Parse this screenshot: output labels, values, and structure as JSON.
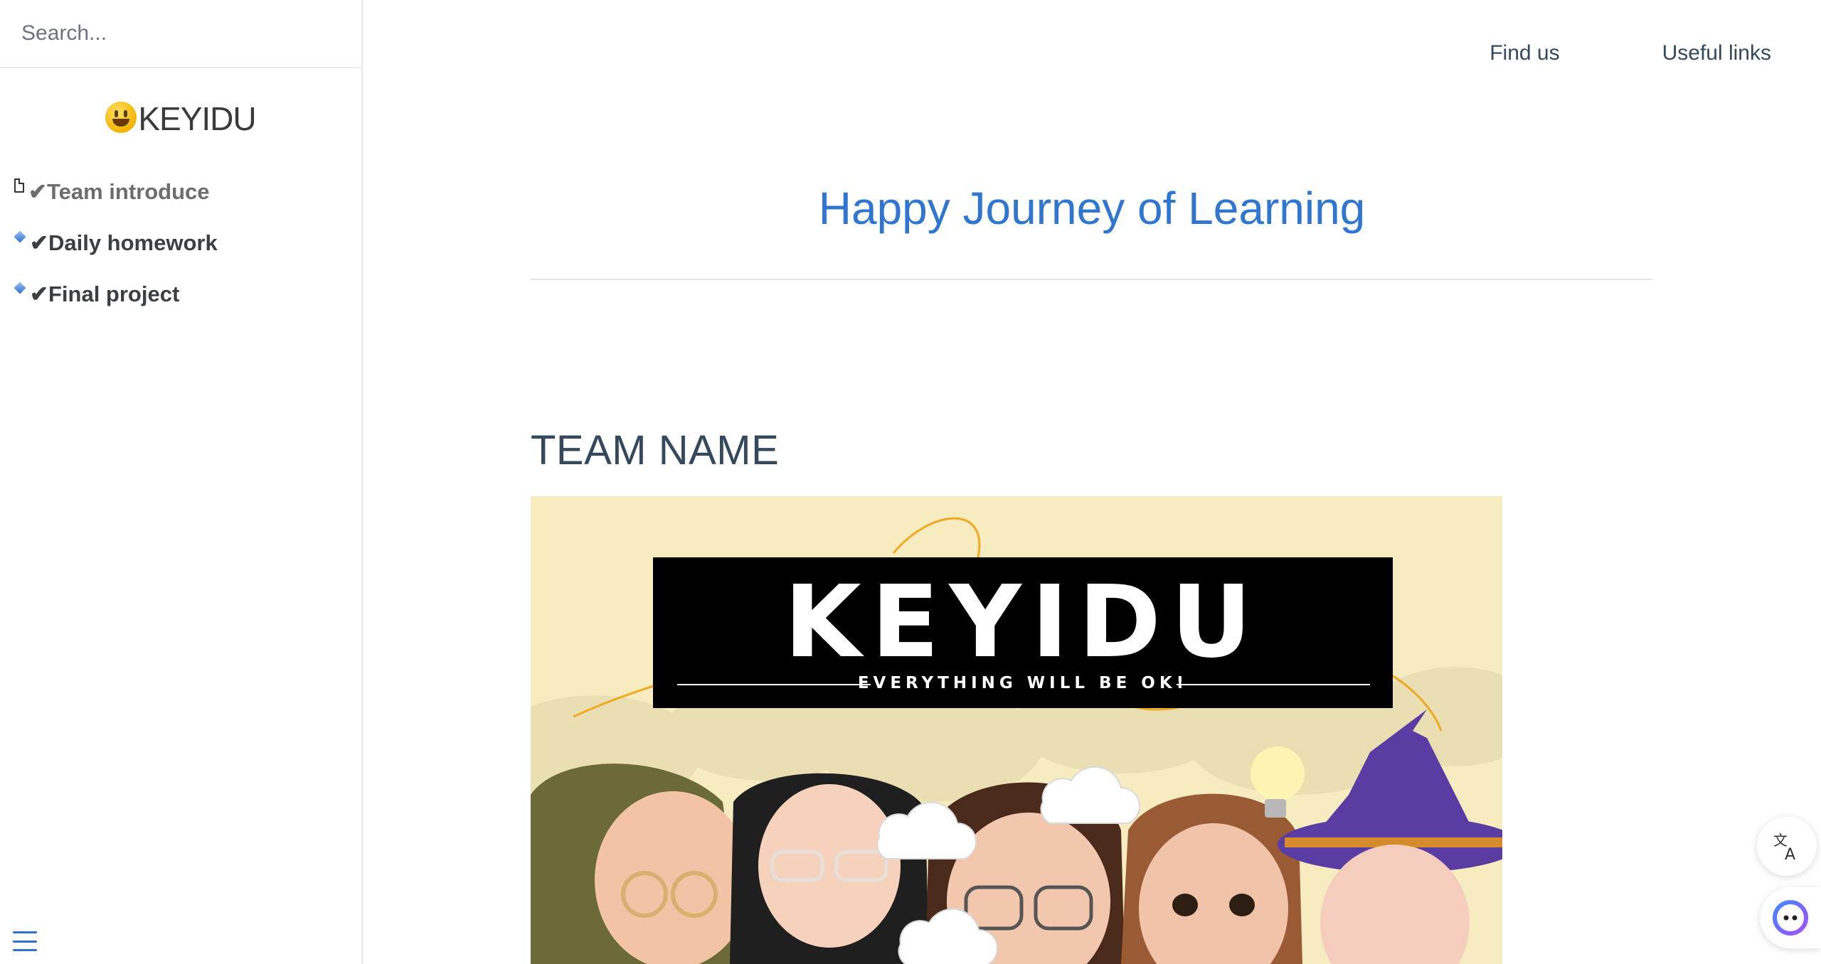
{
  "sidebar": {
    "search_placeholder": "Search...",
    "app_name": "KEYIDU",
    "items": [
      {
        "label": "✔Team introduce"
      },
      {
        "label": "✔Daily homework"
      },
      {
        "label": "✔Final project"
      }
    ]
  },
  "topnav": {
    "links": [
      {
        "label": "Find us"
      },
      {
        "label": "Useful links"
      }
    ]
  },
  "main": {
    "title": "Happy Journey of Learning",
    "section_heading": "TEAM NAME",
    "banner": {
      "logo_text": "KEYIDU",
      "tagline": "EVERYTHING WILL BE OK!"
    }
  },
  "colors": {
    "accent": "#2f76d2",
    "text": "#34495e",
    "banner_bg": "#f6ecbf"
  },
  "icons": {
    "sidebar_item_0": "document-icon",
    "sidebar_item_1": "diamond-icon",
    "sidebar_item_2": "diamond-icon",
    "menu": "hamburger-menu-icon",
    "translate": "translate-icon",
    "assistant": "assistant-icon"
  }
}
